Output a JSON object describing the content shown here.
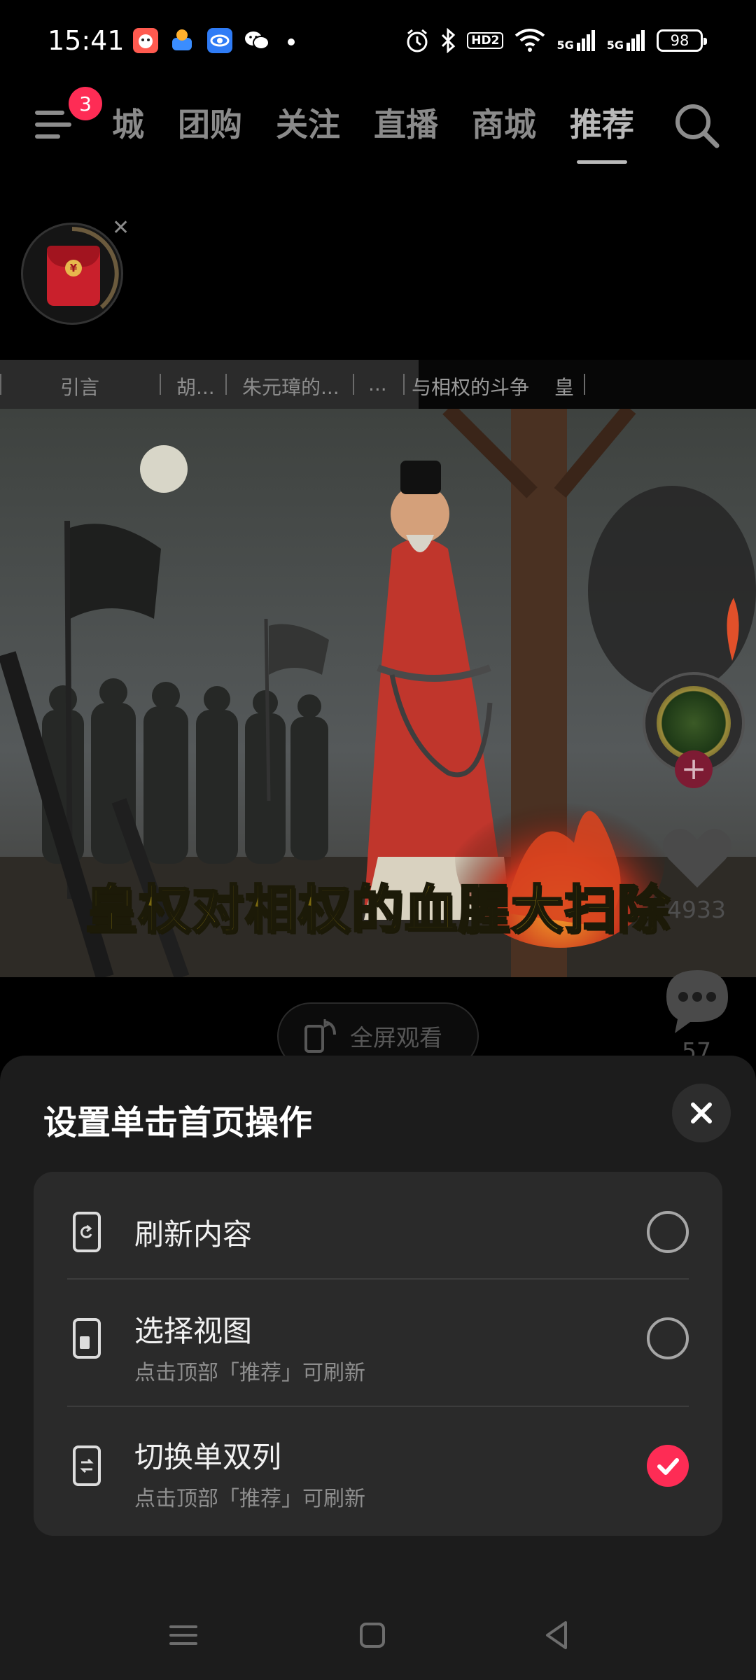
{
  "status_bar": {
    "time": "15:41",
    "app_icons": [
      "app-icon-red",
      "app-icon-game",
      "app-icon-blue",
      "wechat-icon"
    ],
    "hd_label": "HD2",
    "signal1_label": "5G",
    "signal2_label": "5G",
    "battery": "98"
  },
  "top_nav": {
    "notification_badge": "3",
    "tabs": [
      {
        "label": "城",
        "active": false
      },
      {
        "label": "团购",
        "active": false
      },
      {
        "label": "关注",
        "active": false
      },
      {
        "label": "直播",
        "active": false
      },
      {
        "label": "商城",
        "active": false
      },
      {
        "label": "推荐",
        "active": true
      }
    ]
  },
  "red_packet": {
    "coin_symbol": "¥",
    "close_symbol": "✕"
  },
  "chapters": [
    {
      "label": "引言"
    },
    {
      "label": "胡..."
    },
    {
      "label": "朱元璋的..."
    },
    {
      "label": "..."
    },
    {
      "label": "与相权的斗争"
    },
    {
      "label": "皇"
    }
  ],
  "video": {
    "caption": "皇权对相权的血腥大扫除",
    "fullscreen_label": "全屏观看"
  },
  "side_actions": {
    "follow_symbol": "+",
    "like_count": "4933",
    "comment_count": "57"
  },
  "sheet": {
    "title": "设置单击首页操作",
    "options": [
      {
        "label": "刷新内容",
        "sublabel": "",
        "selected": false,
        "icon": "refresh-icon"
      },
      {
        "label": "选择视图",
        "sublabel": "点击顶部「推荐」可刷新",
        "selected": false,
        "icon": "view-icon"
      },
      {
        "label": "切换单双列",
        "sublabel": "点击顶部「推荐」可刷新",
        "selected": true,
        "icon": "switch-columns-icon"
      }
    ]
  },
  "colors": {
    "accent": "#fe2c55",
    "sheet_bg": "#1c1c1c",
    "options_bg": "#2a2a2a"
  }
}
